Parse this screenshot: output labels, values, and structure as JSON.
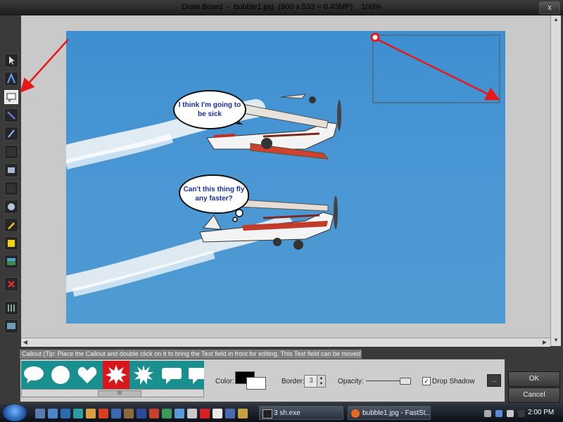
{
  "window": {
    "title": "Draw Board  -  bubble1.jpg  (800 x 533 = 0.43MP)    100%",
    "close_glyph": "x"
  },
  "toolbar": {
    "tools": [
      {
        "icon": "pointer-icon"
      },
      {
        "icon": "text-icon"
      },
      {
        "icon": "callout-icon",
        "selected": true
      },
      {
        "icon": "line-icon"
      },
      {
        "icon": "pencil-icon"
      },
      {
        "icon": "arrow-icon"
      },
      {
        "icon": "rectangle-icon"
      },
      {
        "icon": "rounded-rect-icon"
      },
      {
        "icon": "ellipse-icon"
      },
      {
        "icon": "highlighter-icon"
      },
      {
        "icon": "fill-icon"
      },
      {
        "icon": "image-stamp-icon"
      },
      {
        "icon": "delete-icon"
      },
      {
        "icon": "sliders-icon"
      },
      {
        "icon": "screen-icon"
      }
    ]
  },
  "canvas": {
    "bubble_top_text": "I think I'm going to be sick",
    "bubble_bottom_text": "Can't this thing fly any faster?",
    "sky_color": "#4a96d3",
    "arrow_color": "#e81818"
  },
  "bottom_panel": {
    "callout_tip": "Callout (Tip: Place the Callout and double click on it to bring the Text field in front for editing. This Text field can be moved freely)",
    "shapes": [
      "speech-bubble-icon",
      "circle-icon",
      "heart-icon",
      "explosion-icon",
      "burst-icon",
      "rect-callout-icon",
      "rect-callout-icon"
    ],
    "selected_shape_index": 3,
    "scroll_thumb": "III",
    "color_label": "Color:",
    "border_label": "Border:",
    "border_value": "3",
    "opacity_label": "Opacity:",
    "drop_shadow_label": "Drop Shadow",
    "drop_shadow_checked": true,
    "more_button": "...",
    "ok_label": "OK",
    "cancel_label": "Cancel"
  },
  "taskbar": {
    "items": [
      {
        "label": "3 sh.exe",
        "icon": "console-icon"
      },
      {
        "label": "bubble1.jpg - FastSt...",
        "icon": "faststone-icon"
      }
    ],
    "clock": "2:00 PM"
  }
}
